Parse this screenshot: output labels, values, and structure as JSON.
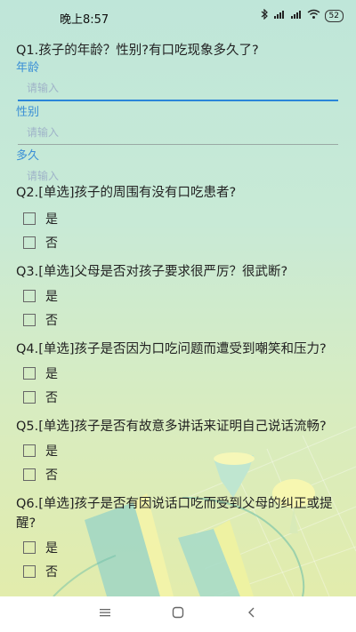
{
  "status": {
    "time": "晚上8:57",
    "battery": "52"
  },
  "q1": {
    "title": "Q1.孩子的年龄？性别?有口吃现象多久了?",
    "fields": [
      {
        "label": "年龄",
        "placeholder": "请输入"
      },
      {
        "label": "性别",
        "placeholder": "请输入"
      },
      {
        "label": "多久",
        "placeholder": "请输入"
      }
    ]
  },
  "q2": {
    "title": "Q2.[单选]孩子的周围有没有口吃患者?",
    "options": [
      "是",
      "否"
    ]
  },
  "q3": {
    "title": "Q3.[单选]父母是否对孩子要求很严厉？很武断?",
    "options": [
      "是",
      "否"
    ]
  },
  "q4": {
    "title": "Q4.[单选]孩子是否因为口吃问题而遭受到嘲笑和压力?",
    "options": [
      "是",
      "否"
    ]
  },
  "q5": {
    "title": "Q5.[单选]孩子是否有故意多讲话来证明自己说话流畅?",
    "options": [
      "是",
      "否"
    ]
  },
  "q6": {
    "title": "Q6.[单选]孩子是否有因说话口吃而受到父母的纠正或提醒?",
    "options": [
      "是",
      "否"
    ]
  }
}
